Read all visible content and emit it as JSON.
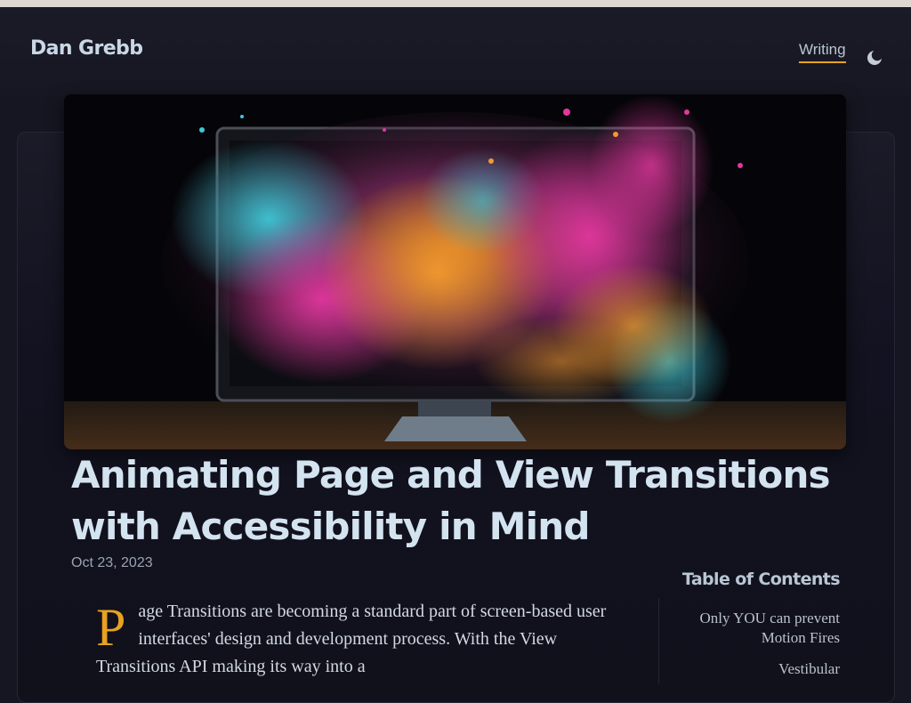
{
  "site": {
    "title": "Dan Grebb"
  },
  "nav": {
    "items": [
      {
        "label": "Writing",
        "active": true
      }
    ],
    "theme_toggle_icon": "moon-icon",
    "accent_color": "#e8a21f"
  },
  "hero": {
    "description": "Computer monitor with colorful paint explosion"
  },
  "article": {
    "title": "Animating Page and View Transitions with Accessibility in Mind",
    "date": "Oct 23, 2023",
    "drop_cap": "P",
    "intro": "age Transitions are becoming a standard part of screen-based user interfaces' design and development process. With the View Transitions API making its way into a"
  },
  "toc": {
    "title": "Table of Contents",
    "items": [
      {
        "label": "Only YOU can prevent Motion Fires"
      },
      {
        "label": "Vestibular"
      }
    ]
  }
}
